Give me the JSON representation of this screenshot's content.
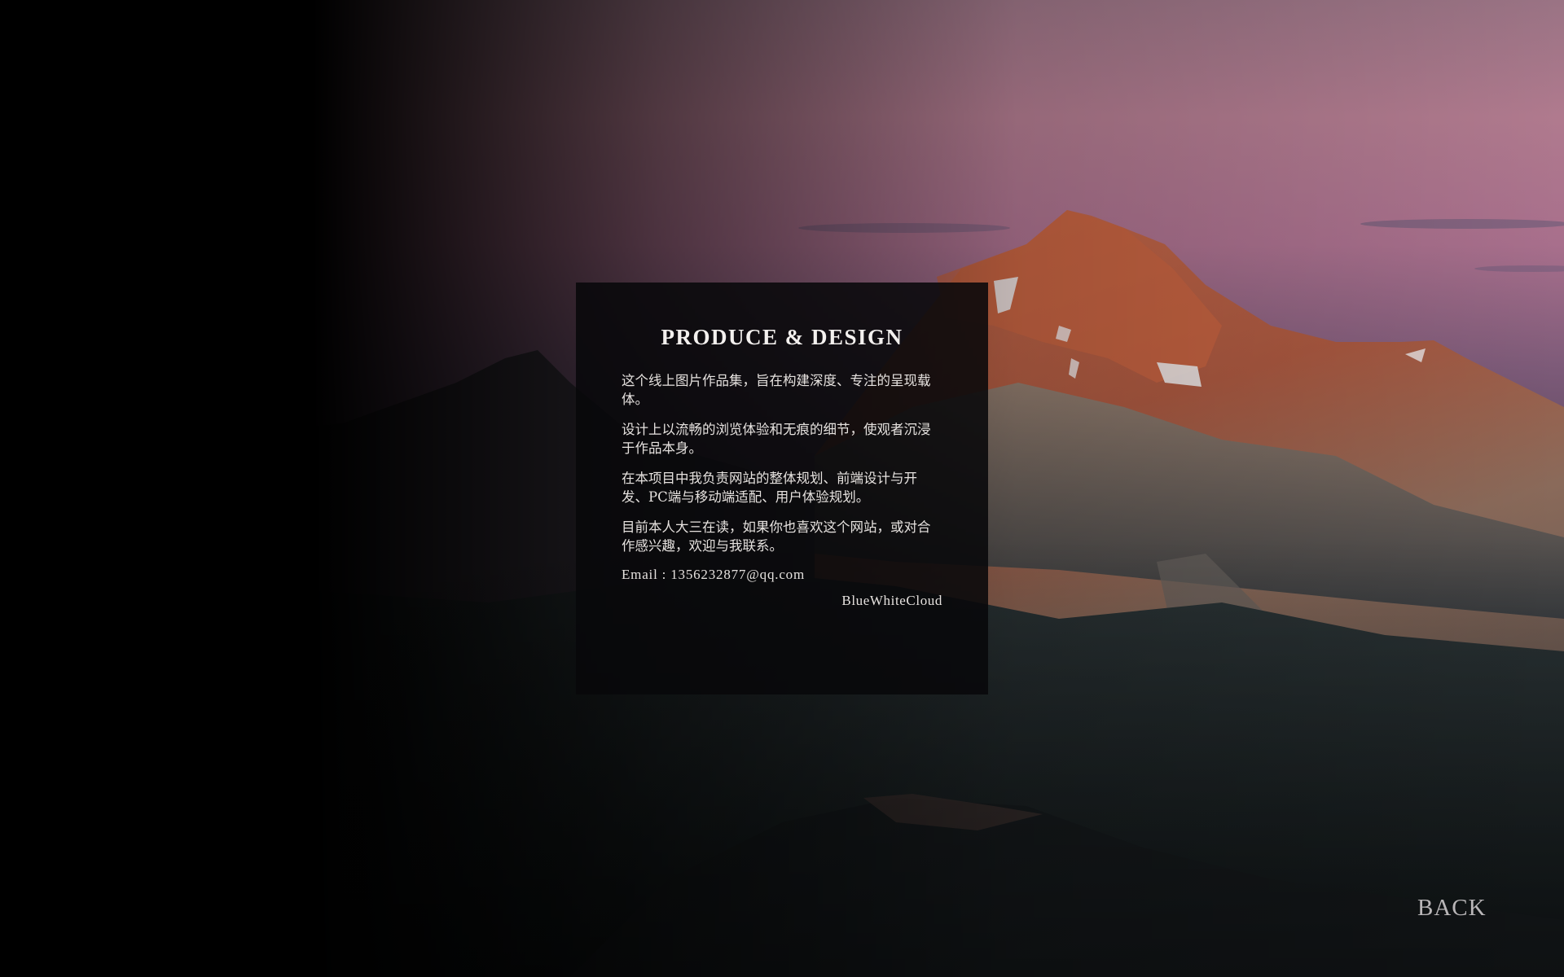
{
  "info": {
    "title": "PRODUCE & DESIGN",
    "paragraphs": [
      "这个线上图片作品集，旨在构建深度、专注的呈现载体。",
      "设计上以流畅的浏览体验和无痕的细节，使观者沉浸于作品本身。",
      "在本项目中我负责网站的整体规划、前端设计与开发、PC端与移动端适配、用户体验规划。",
      "目前本人大三在读，如果你也喜欢这个网站，或对合作感兴趣，欢迎与我联系。"
    ],
    "email": "Email : 1356232877@qq.com",
    "signature": "BlueWhiteCloud"
  },
  "nav": {
    "back_label": "BACK"
  },
  "colors": {
    "sky_top": "#b07890",
    "peak_alpenglow": "#c8633f",
    "overlay": "#08080a",
    "text": "#ebe7e4",
    "back_text": "#b9b6b8"
  },
  "background": {
    "icon": "mountain-sunset-photo"
  }
}
